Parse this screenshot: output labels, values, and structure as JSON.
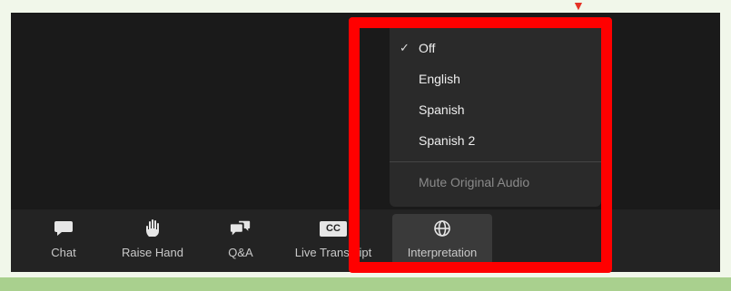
{
  "toolbar": {
    "items": [
      {
        "label": "Chat",
        "icon": "chat-bubble-icon"
      },
      {
        "label": "Raise Hand",
        "icon": "raise-hand-icon"
      },
      {
        "label": "Q&A",
        "icon": "qa-bubbles-icon"
      },
      {
        "label": "Live Transcript",
        "icon": "cc-icon"
      },
      {
        "label": "Interpretation",
        "icon": "globe-icon"
      }
    ],
    "cc_text": "CC"
  },
  "menu": {
    "items": [
      {
        "label": "Off",
        "checked": true
      },
      {
        "label": "English",
        "checked": false
      },
      {
        "label": "Spanish",
        "checked": false
      },
      {
        "label": "Spanish 2",
        "checked": false
      }
    ],
    "check_mark": "✓",
    "mute_label": "Mute Original Audio"
  },
  "colors": {
    "highlight": "#ff0000",
    "window_bg": "#1a1a1a",
    "footer_green": "#a9d08e",
    "page_bg": "#f1f7ea"
  }
}
